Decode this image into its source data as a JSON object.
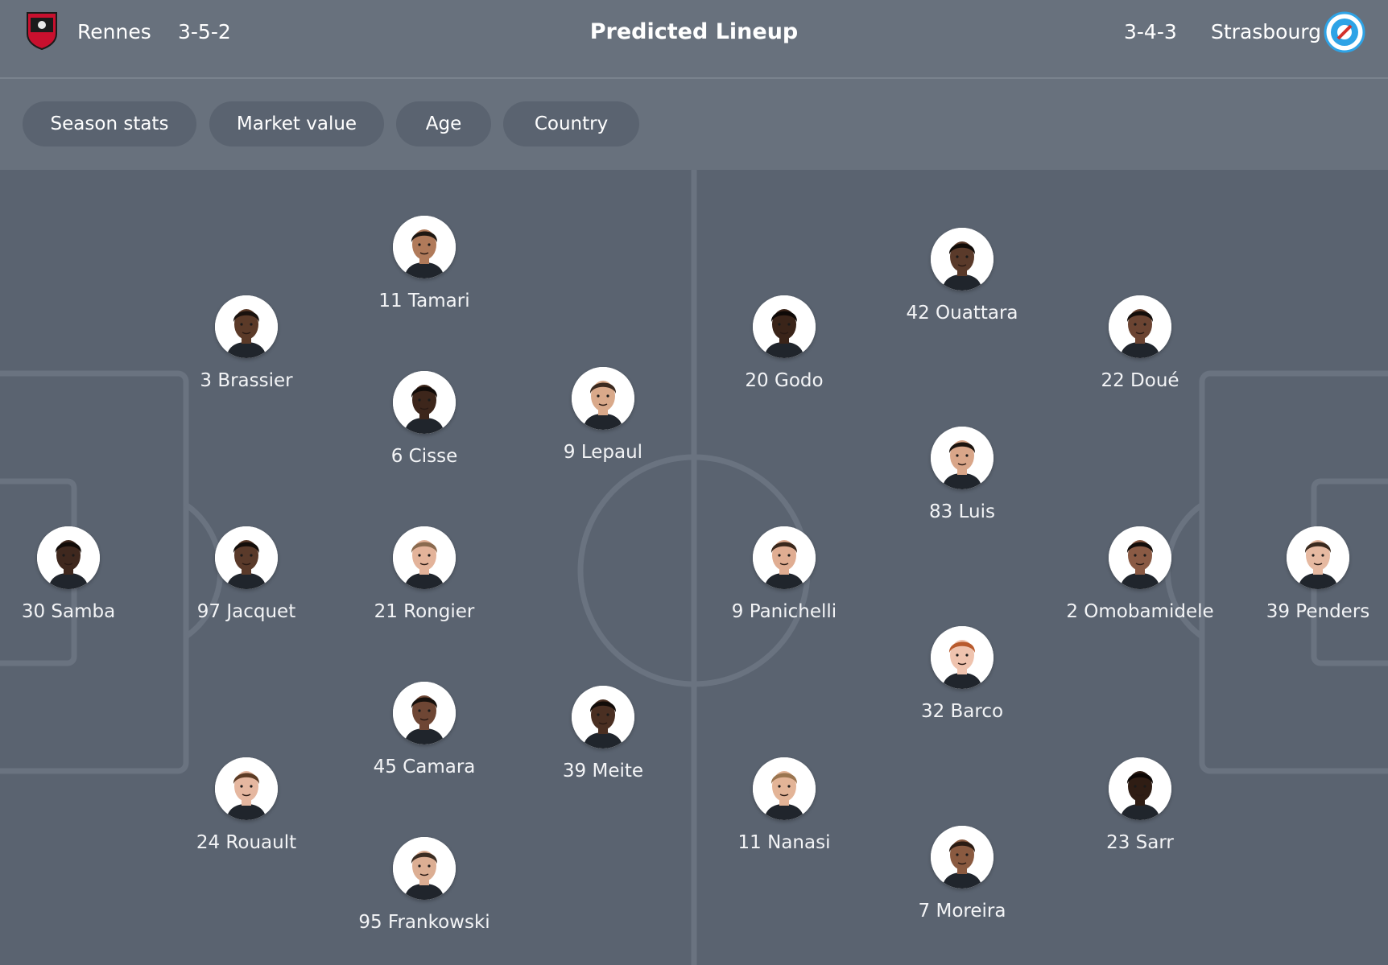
{
  "header": {
    "title": "Predicted Lineup",
    "home": {
      "name": "Rennes",
      "formation": "3-5-2",
      "crest_color": "#c8102e"
    },
    "away": {
      "name": "Strasbourg",
      "formation": "3-4-3",
      "crest_color": "#2ea3e6"
    }
  },
  "filters": [
    "Season stats",
    "Market value",
    "Age",
    "Country"
  ],
  "home_players": [
    {
      "label": "11 Tamari",
      "skin": "#b07a5a",
      "hair": "#1e1712"
    },
    {
      "label": "3 Brassier",
      "skin": "#5b3a28",
      "hair": "#1a120e"
    },
    {
      "label": "6 Cisse",
      "skin": "#3d261b",
      "hair": "#120c09"
    },
    {
      "label": "9 Lepaul",
      "skin": "#d9a98a",
      "hair": "#3b2a20"
    },
    {
      "label": "30 Samba",
      "skin": "#3f281e",
      "hair": "#120c09"
    },
    {
      "label": "97 Jacquet",
      "skin": "#5a3a2a",
      "hair": "#140e0b"
    },
    {
      "label": "21 Rongier",
      "skin": "#e3b39a",
      "hair": "#8a6a4f"
    },
    {
      "label": "45 Camara",
      "skin": "#6e4634",
      "hair": "#17110d"
    },
    {
      "label": "39 Meite",
      "skin": "#4a2f22",
      "hair": "#120c09"
    },
    {
      "label": "24 Rouault",
      "skin": "#e5b7a0",
      "hair": "#5b3b25"
    },
    {
      "label": "95 Frankowski",
      "skin": "#dcae93",
      "hair": "#3a2c22"
    }
  ],
  "away_players": [
    {
      "label": "42 Ouattara",
      "skin": "#5a3a2a",
      "hair": "#100b08"
    },
    {
      "label": "20 Godo",
      "skin": "#3a2419",
      "hair": "#0e0907"
    },
    {
      "label": "22 Doué",
      "skin": "#6b4432",
      "hair": "#140e0b"
    },
    {
      "label": "83 Luis",
      "skin": "#d9a689",
      "hair": "#1c140f"
    },
    {
      "label": "9 Panichelli",
      "skin": "#e0ad92",
      "hair": "#3a281c"
    },
    {
      "label": "2 Omobamidele",
      "skin": "#8a5a44",
      "hair": "#140e0b"
    },
    {
      "label": "39 Penders",
      "skin": "#e6b9a1",
      "hair": "#3a2a1f"
    },
    {
      "label": "32 Barco",
      "skin": "#efc3ae",
      "hair": "#b85a2d"
    },
    {
      "label": "11 Nanasi",
      "skin": "#e3b497",
      "hair": "#9a7550"
    },
    {
      "label": "23 Sarr",
      "skin": "#2f1d14",
      "hair": "#0d0806"
    },
    {
      "label": "7 Moreira",
      "skin": "#8a5a40",
      "hair": "#2a1b13"
    }
  ]
}
